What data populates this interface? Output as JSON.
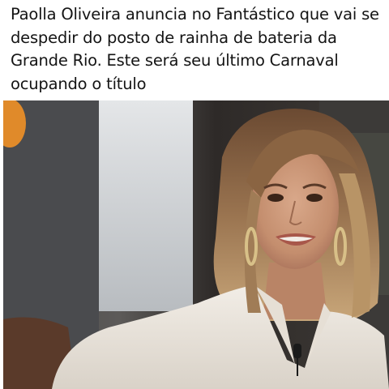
{
  "post": {
    "text": "Paolla Oliveira anuncia no Fantástico que vai se despedir do posto de rainha de bateria da Grande Rio. Este será seu último Carnaval ocupando o título"
  },
  "media": {
    "type": "video-still",
    "description_icon": "woman-speaking-photo"
  },
  "colors": {
    "background": "#ffffff",
    "text": "#141414"
  }
}
